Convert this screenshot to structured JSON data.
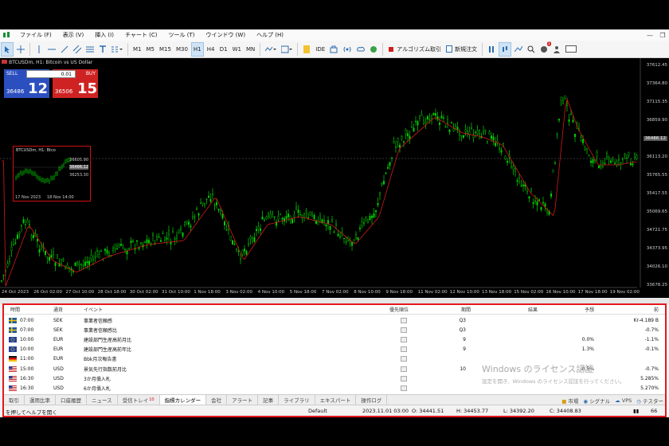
{
  "menu": {
    "items": [
      "ファイル (F)",
      "表示 (V)",
      "挿入 (I)",
      "チャート (C)",
      "ツール (T)",
      "ウインドウ (W)",
      "ヘルプ (H)"
    ]
  },
  "toolbar": {
    "timeframes": [
      "M1",
      "M5",
      "M15",
      "M30",
      "H1",
      "H4",
      "D1",
      "W1",
      "MN"
    ],
    "active_timeframe": "H1",
    "ide_label": "IDE",
    "algo_label": "アルゴリズム取引",
    "new_order_label": "新規注文",
    "notif_count": "1"
  },
  "chart": {
    "title": "BTCUSDm, H1:  Bitcoin vs US Dollar",
    "trade": {
      "sell_label": "SELL",
      "buy_label": "BUY",
      "lot": "0.01",
      "sell_small": "36486",
      "sell_big": "12",
      "buy_small": "36506",
      "buy_big": "15"
    },
    "mini": {
      "title": "BTCUSDm, H1:  Btco",
      "p1": "36605.90",
      "p2": "36486.12",
      "p3": "36253.30",
      "d1": "17 Nov 2023",
      "d2": "18 Nov 14:00"
    },
    "price_labels": [
      "37612.45",
      "37364.80",
      "37115.35",
      "36859.90",
      "36486.12",
      "36113.20",
      "35765.55",
      "35417.55",
      "35069.65",
      "34721.75",
      "34373.95",
      "34026.10",
      "33678.25"
    ],
    "current_price": "36486.12",
    "time_labels": [
      "24 Oct 2023",
      "26 Oct 02:00",
      "27 Oct 10:00",
      "28 Oct 18:00",
      "30 Oct 02:00",
      "31 Oct 10:00",
      "1 Nov 18:00",
      "3 Nov 02:00",
      "4 Nov 10:00",
      "5 Nov 18:00",
      "7 Nov 02:00",
      "8 Nov 10:00",
      "9 Nov 18:00",
      "11 Nov 02:00",
      "12 Nov 10:00",
      "13 Nov 18:00",
      "15 Nov 02:00",
      "16 Nov 10:00",
      "17 Nov 18:00",
      "19 Nov 02:00"
    ]
  },
  "calendar": {
    "headers": {
      "time": "時間",
      "currency": "通貨",
      "event": "イベント",
      "priority": "優先順位",
      "period": "期間",
      "actual": "結果",
      "forecast": "予想",
      "previous": "前"
    },
    "rows": [
      {
        "flag": "se",
        "time": "07:00",
        "currency": "SEK",
        "event": "事業者信頼感",
        "period": "Q3",
        "actual": "",
        "forecast": "",
        "previous": "Kr-4.189 B"
      },
      {
        "flag": "se",
        "time": "07:00",
        "currency": "SEK",
        "event": "事業者信頼感比",
        "period": "Q3",
        "actual": "",
        "forecast": "",
        "previous": "-0.7%"
      },
      {
        "flag": "eu",
        "time": "10:00",
        "currency": "EUR",
        "event": "建設部門生産高前月比",
        "period": "9",
        "actual": "",
        "forecast": "0.0%",
        "previous": "-1.1%"
      },
      {
        "flag": "eu",
        "time": "10:00",
        "currency": "EUR",
        "event": "建設部門生産高前年比",
        "period": "9",
        "actual": "",
        "forecast": "1.3%",
        "previous": "-0.1%"
      },
      {
        "flag": "de",
        "time": "11:00",
        "currency": "EUR",
        "event": "Bbk月次報告書",
        "period": "",
        "actual": "",
        "forecast": "",
        "previous": ""
      },
      {
        "flag": "us",
        "time": "15:00",
        "currency": "USD",
        "event": "景気先行指数前月比",
        "period": "10",
        "actual": "",
        "forecast": "-0.5%",
        "previous": "-0.7%"
      },
      {
        "flag": "us",
        "time": "16:30",
        "currency": "USD",
        "event": "3か月債入札",
        "period": "",
        "actual": "",
        "forecast": "",
        "previous": "5.285%"
      },
      {
        "flag": "us",
        "time": "16:30",
        "currency": "USD",
        "event": "6か月債入札",
        "period": "",
        "actual": "",
        "forecast": "",
        "previous": "5.270%"
      }
    ],
    "watermark_title": "Windows のライセンス認証",
    "watermark_text": "設定を開き、Windows のライセンス認証を行ってください。"
  },
  "bottom_tabs": [
    {
      "label": "取引",
      "count": ""
    },
    {
      "label": "運用比率",
      "count": ""
    },
    {
      "label": "口座履歴",
      "count": ""
    },
    {
      "label": "ニュース",
      "count": ""
    },
    {
      "label": "受信トレイ",
      "count": "10"
    },
    {
      "label": "指標カレンダー",
      "count": ""
    },
    {
      "label": "会社",
      "count": ""
    },
    {
      "label": "アラート",
      "count": ""
    },
    {
      "label": "記事",
      "count": ""
    },
    {
      "label": "ライブラリ",
      "count": ""
    },
    {
      "label": "エキスパート",
      "count": ""
    },
    {
      "label": "操作ログ",
      "count": ""
    }
  ],
  "active_bottom_tab": "指標カレンダー",
  "right_tools": {
    "market": "市場",
    "signals": "シグナル",
    "vps": "VPS",
    "tester": "テスター"
  },
  "status": {
    "help": "を押してヘルプを開く",
    "profile": "Default",
    "datetime": "2023.11.01 03:00",
    "open": "O: 34441.51",
    "high": "H: 34453.77",
    "low": "L: 34392.20",
    "close": "C: 34408.83",
    "signal": "66"
  },
  "colors": {
    "bull": "#00d400",
    "bear": "#00d400",
    "ma": "#d11a1a",
    "sell": "#2c4fbf",
    "buy": "#cf2323",
    "highlight_border": "#e4181e"
  }
}
